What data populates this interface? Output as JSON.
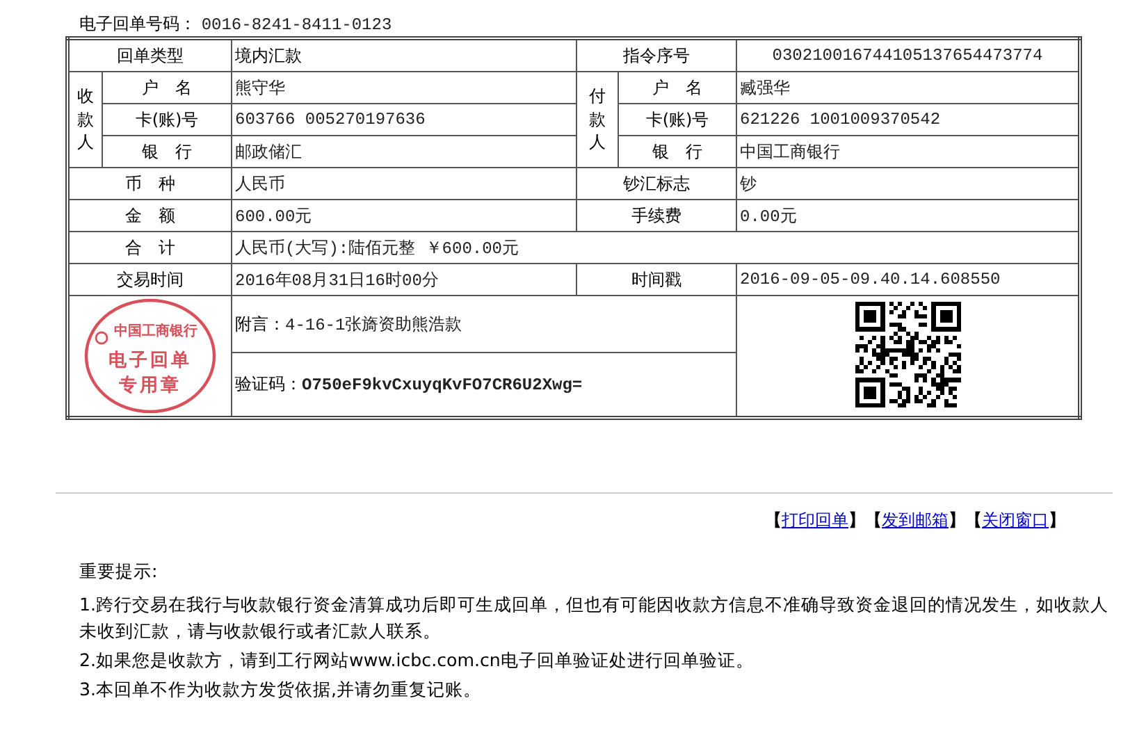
{
  "receipt_number": {
    "label": "电子回单号码：",
    "value": "0016-8241-8411-0123"
  },
  "receipt": {
    "type": {
      "label": "回单类型",
      "value": "境内汇款"
    },
    "instruction_no": {
      "label": "指令序号",
      "value": "030210016744105137654473774"
    },
    "payee": {
      "title": "收款人",
      "fields": [
        {
          "label": "户　名",
          "value": "熊守华"
        },
        {
          "label": "卡(账)号",
          "value": "603766  005270197636"
        },
        {
          "label": "银　行",
          "value": "邮政储汇"
        }
      ]
    },
    "payer": {
      "title": "付款人",
      "fields": [
        {
          "label": "户　名",
          "value": "臧强华"
        },
        {
          "label": "卡(账)号",
          "value": "621226  1001009370542"
        },
        {
          "label": "银　行",
          "value": "中国工商银行"
        }
      ]
    },
    "pairs": [
      [
        {
          "label": "币　种",
          "value": "人民币"
        },
        {
          "label": "钞汇标志",
          "value": "钞"
        }
      ],
      [
        {
          "label": "金　额",
          "value": "600.00元"
        },
        {
          "label": "手续费",
          "value": "0.00元"
        }
      ]
    ],
    "total": {
      "label": "合　计",
      "value": "人民币(大写):陆佰元整  ￥600.00元"
    },
    "trade_time": {
      "label": "交易时间",
      "value": "2016年08月31日16时00分"
    },
    "timestamp": {
      "label": "时间戳",
      "value": "2016-09-05-09.40.14.608550"
    },
    "stamp": {
      "arc": "中国工商银行",
      "lines": [
        "电子回单",
        "专用章"
      ]
    },
    "remark": {
      "label": "附言：",
      "value": "4-16-1张旖资助熊浩款"
    },
    "verification": {
      "label": "验证码：",
      "value": "O750eF9kvCxuyqKvFO7CR6U2Xwg="
    }
  },
  "actions": {
    "open": "【",
    "close": "】",
    "items": [
      "打印回单",
      "发到邮箱",
      "关闭窗口"
    ]
  },
  "notes": {
    "title": "重要提示:",
    "items": [
      "1.跨行交易在我行与收款银行资金清算成功后即可生成回单，但也有可能因收款方信息不准确导致资金退回的情况发生，如收款人未收到汇款，请与收款银行或者汇款人联系。",
      "2.如果您是收款方，请到工行网站www.icbc.com.cn电子回单验证处进行回单验证。",
      "3.本回单不作为收款方发货依据,并请勿重复记账。"
    ]
  }
}
